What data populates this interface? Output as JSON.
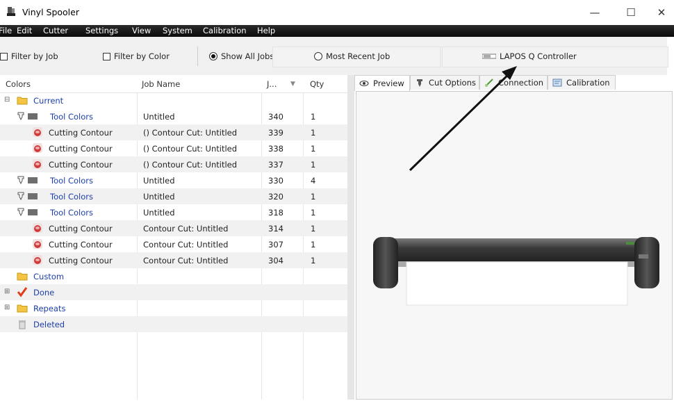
{
  "window": {
    "title": "Vinyl Spooler",
    "minimize_glyph": "—",
    "maximize_glyph": "☐",
    "close_glyph": "✕"
  },
  "menu": [
    "File",
    "Edit",
    "Cutter",
    "Settings",
    "View",
    "System",
    "Calibration",
    "Help"
  ],
  "toolbar": {
    "filter_job": "Filter by Job",
    "filter_color": "Filter by Color",
    "show_all": "Show All Jobs",
    "most_recent": "Most Recent Job",
    "controller": "LAPOS Q Controller"
  },
  "table": {
    "headers": {
      "colors": "Colors",
      "job_name": "Job Name",
      "job": "J...",
      "sort_glyph": "▼",
      "qty": "Qty"
    },
    "rows": [
      {
        "label": "Current",
        "name": "",
        "job": "",
        "qty": "",
        "icon": "folder-icon",
        "indent": 0,
        "expander": "⊟"
      },
      {
        "label": "Tool Colors",
        "name": "Untitled",
        "job": "340",
        "qty": "1",
        "icon": "tool-color-icon",
        "indent": 1
      },
      {
        "label": "Cutting Contour",
        "name": "() Contour Cut: Untitled",
        "job": "339",
        "qty": "1",
        "icon": "contour-icon",
        "indent": 2
      },
      {
        "label": "Cutting Contour",
        "name": "() Contour Cut: Untitled",
        "job": "338",
        "qty": "1",
        "icon": "contour-icon",
        "indent": 2
      },
      {
        "label": "Cutting Contour",
        "name": "() Contour Cut: Untitled",
        "job": "337",
        "qty": "1",
        "icon": "contour-icon",
        "indent": 2
      },
      {
        "label": "Tool Colors",
        "name": "Untitled",
        "job": "330",
        "qty": "4",
        "icon": "tool-color-icon",
        "indent": 1
      },
      {
        "label": "Tool Colors",
        "name": "Untitled",
        "job": "320",
        "qty": "1",
        "icon": "tool-color-icon",
        "indent": 1
      },
      {
        "label": "Tool Colors",
        "name": "Untitled",
        "job": "318",
        "qty": "1",
        "icon": "tool-color-icon",
        "indent": 1
      },
      {
        "label": "Cutting Contour",
        "name": "Contour Cut: Untitled",
        "job": "314",
        "qty": "1",
        "icon": "contour-icon",
        "indent": 2
      },
      {
        "label": "Cutting Contour",
        "name": "Contour Cut: Untitled",
        "job": "307",
        "qty": "1",
        "icon": "contour-icon",
        "indent": 2
      },
      {
        "label": "Cutting Contour",
        "name": "Contour Cut: Untitled",
        "job": "304",
        "qty": "1",
        "icon": "contour-icon",
        "indent": 2
      },
      {
        "label": "Custom",
        "name": "",
        "job": "",
        "qty": "",
        "icon": "folder-icon",
        "indent": 0
      },
      {
        "label": "Done",
        "name": "",
        "job": "",
        "qty": "",
        "icon": "checkmark-icon",
        "indent": 0,
        "expander": "⊞"
      },
      {
        "label": "Repeats",
        "name": "",
        "job": "",
        "qty": "",
        "icon": "folder-icon",
        "indent": 0,
        "expander": "⊞"
      },
      {
        "label": "Deleted",
        "name": "",
        "job": "",
        "qty": "",
        "icon": "trash-icon",
        "indent": 0
      }
    ]
  },
  "tabs": [
    "Preview",
    "Cut Options",
    "Connection",
    "Calibration"
  ],
  "colors": {
    "link_blue": "#1d3fa8",
    "menubar": "#111111",
    "alt_row": "#f1f1f1",
    "folder": "#f4c542",
    "check": "#e23b1a"
  }
}
